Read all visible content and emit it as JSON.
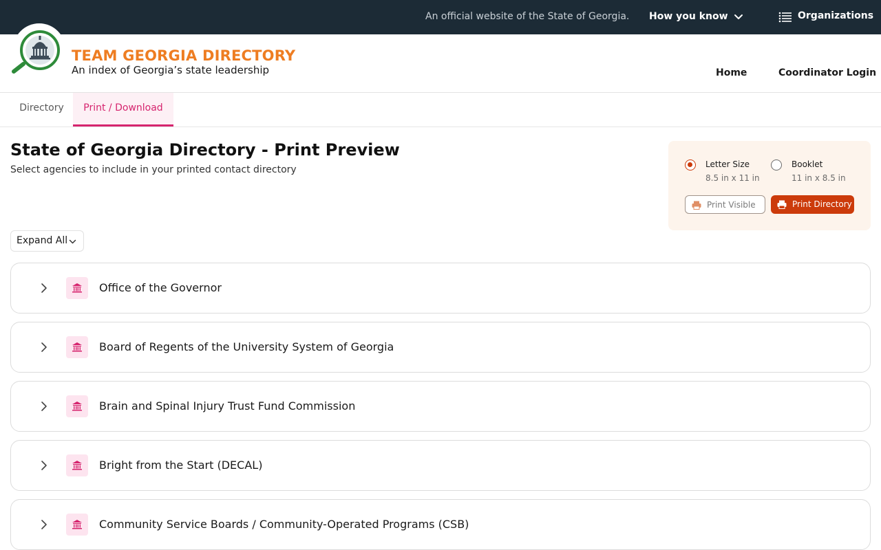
{
  "banner": {
    "official_text": "An official website of the State of Georgia.",
    "how_you_know": "How you know",
    "organizations": "Organizations"
  },
  "header": {
    "brand_title": "TEAM GEORGIA DIRECTORY",
    "brand_subtitle": "An index of Georgia’s state leadership",
    "nav": {
      "home": "Home",
      "coordinator_login": "Coordinator Login"
    }
  },
  "tabs": [
    {
      "label": "Directory",
      "active": false
    },
    {
      "label": "Print / Download",
      "active": true
    }
  ],
  "main": {
    "title": "State of Georgia Directory - Print Preview",
    "description": "Select agencies to include in your printed contact directory"
  },
  "print_options": {
    "letter": {
      "label": "Letter Size",
      "size": "8.5 in x 11 in",
      "selected": true
    },
    "booklet": {
      "label": "Booklet",
      "size": "11 in x 8.5 in",
      "selected": false
    },
    "print_visible": "Print Visible",
    "print_directory": "Print Directory"
  },
  "expand_all": "Expand All",
  "agencies": [
    {
      "name": "Office of the Governor",
      "icon": "building-icon"
    },
    {
      "name": "Board of Regents of the University System of Georgia",
      "icon": "building-icon"
    },
    {
      "name": "Brain and Spinal Injury Trust Fund Commission",
      "icon": "building-icon"
    },
    {
      "name": "Bright from the Start (DECAL)",
      "icon": "building-icon"
    },
    {
      "name": "Community Service Boards / Community-Operated Programs (CSB)",
      "icon": "building-icon"
    }
  ],
  "colors": {
    "banner_bg": "#1c2b36",
    "brand_orange": "#ee7d22",
    "accent_pink": "#d6246e",
    "print_red": "#cc3b0b",
    "panel_bg": "#fdf4ec"
  }
}
